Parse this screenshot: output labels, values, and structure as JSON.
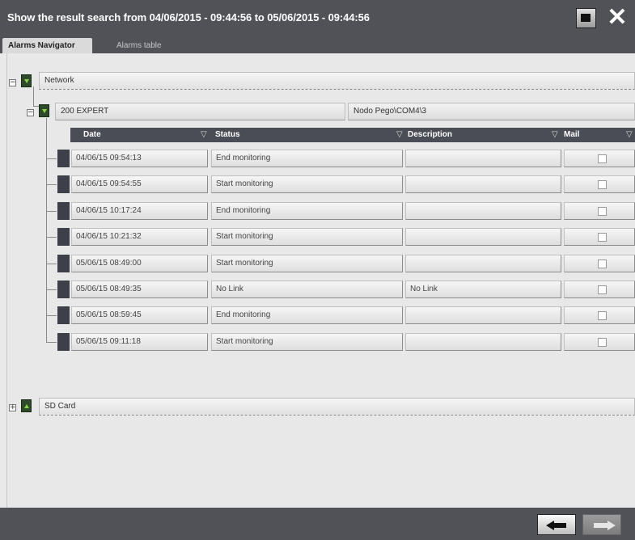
{
  "window": {
    "title": "Show the result search from 04/06/2015 - 09:44:56 to 05/06/2015 - 09:44:56"
  },
  "tabs": [
    {
      "label": "Alarms Navigator",
      "active": true
    },
    {
      "label": "Alarms table",
      "active": false
    }
  ],
  "tree": {
    "network": {
      "label": "Network",
      "expander": "−"
    },
    "device": {
      "label": "200 EXPERT",
      "node": "Nodo Pego\\COM4\\3",
      "expander": "−"
    },
    "sdcard": {
      "label": "SD Card",
      "expander": "+"
    }
  },
  "table": {
    "columns": [
      "Date",
      "Status",
      "Description",
      "Mail"
    ],
    "filter_glyph": "▽",
    "rows": [
      {
        "date": "04/06/15 09:54:13",
        "status": "End monitoring",
        "description": "",
        "mail": false
      },
      {
        "date": "04/06/15 09:54:55",
        "status": "Start monitoring",
        "description": "",
        "mail": false
      },
      {
        "date": "04/06/15 10:17:24",
        "status": "End monitoring",
        "description": "",
        "mail": false
      },
      {
        "date": "04/06/15 10:21:32",
        "status": "Start monitoring",
        "description": "",
        "mail": false
      },
      {
        "date": "05/06/15 08:49:00",
        "status": "Start monitoring",
        "description": "",
        "mail": false
      },
      {
        "date": "05/06/15 08:49:35",
        "status": "No Link",
        "description": "No Link",
        "mail": false
      },
      {
        "date": "05/06/15 08:59:45",
        "status": "End monitoring",
        "description": "",
        "mail": false
      },
      {
        "date": "05/06/15 09:11:18",
        "status": "Start monitoring",
        "description": "",
        "mail": false
      }
    ]
  },
  "icons": {
    "close": "close-icon",
    "fullscreen": "screen-icon",
    "back": "arrow-left-icon",
    "forward": "arrow-right-icon"
  },
  "colors": {
    "chrome": "#505258",
    "header": "#4a4d55",
    "tree_node": "#2f4a2a",
    "tree_node_arrow": "#8ad24a"
  }
}
